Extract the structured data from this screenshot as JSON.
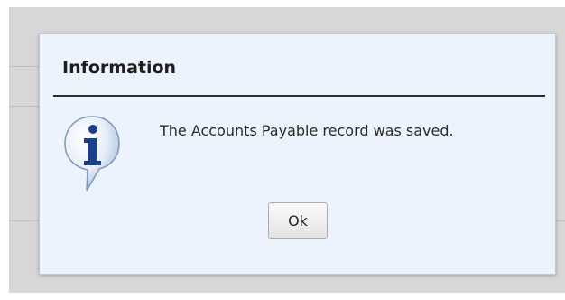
{
  "dialog": {
    "title": "Information",
    "message": "The Accounts Payable record was saved.",
    "ok_label": "Ok",
    "icon": "info-icon"
  },
  "colors": {
    "dialog_background": "#edf3fc",
    "backdrop": "#d7d7d7",
    "icon_blue": "#1b3f8f"
  }
}
